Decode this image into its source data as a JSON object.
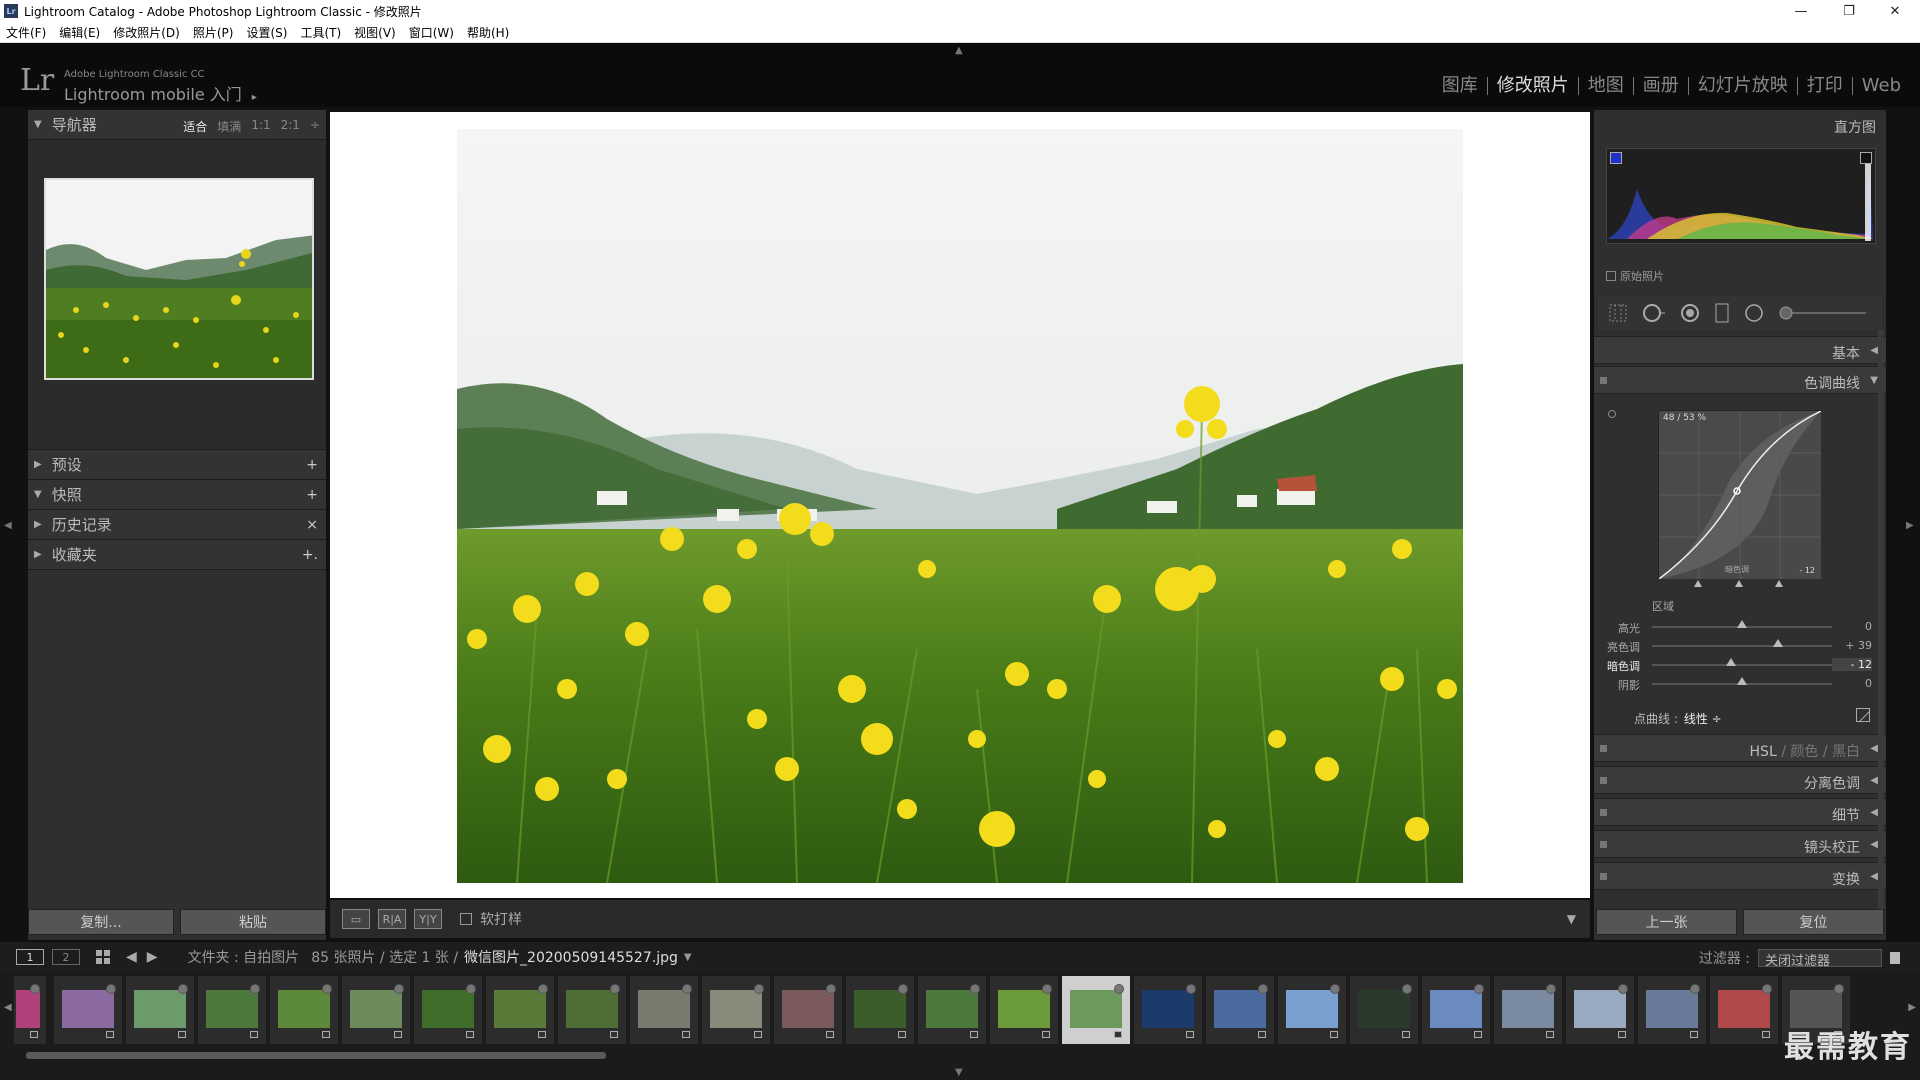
{
  "window": {
    "title": "Lightroom Catalog - Adobe Photoshop Lightroom Classic - 修改照片",
    "app_icon": "Lr"
  },
  "menu": [
    "文件(F)",
    "编辑(E)",
    "修改照片(D)",
    "照片(P)",
    "设置(S)",
    "工具(T)",
    "视图(V)",
    "窗口(W)",
    "帮助(H)"
  ],
  "header": {
    "logo": "Lr",
    "product": "Adobe Lightroom Classic CC",
    "mobile": "Lightroom mobile 入门",
    "mobile_arrow": "▸",
    "modules": [
      "图库",
      "修改照片",
      "地图",
      "画册",
      "幻灯片放映",
      "打印",
      "Web"
    ],
    "active_module": "修改照片"
  },
  "left": {
    "navigator": {
      "title": "导航器",
      "zoom": [
        "适合",
        "填满",
        "1:1",
        "2:1"
      ],
      "zoom_selected": "适合",
      "zoom_more": "÷"
    },
    "panels": [
      {
        "title": "预设",
        "action": "+",
        "tri": "▶"
      },
      {
        "title": "快照",
        "action": "+",
        "tri": "▼"
      },
      {
        "title": "历史记录",
        "action": "×",
        "tri": "▶"
      },
      {
        "title": "收藏夹",
        "action": "+.",
        "tri": "▶"
      }
    ],
    "buttons": {
      "copy": "复制...",
      "paste": "粘贴"
    }
  },
  "toolbar": {
    "ba_label": "R|A",
    "yy_label": "Y|Y",
    "softproof": "软打样",
    "dropdown": "▼"
  },
  "right": {
    "histogram": {
      "title": "直方图"
    },
    "original": "原始照片",
    "panels": {
      "basic": "基本",
      "tone_curve": "色调曲线",
      "hsl": "HSL",
      "color": "颜色",
      "bw": "黑白",
      "split": "分离色调",
      "detail": "细节",
      "lens": "镜头校正",
      "transform": "变换"
    },
    "curve": {
      "readout": "48 / 53 %",
      "foot_label": "暗色调",
      "foot_value": "- 12"
    },
    "region_label": "区域",
    "sliders": [
      {
        "name": "高光",
        "value": "0",
        "pos": 0.5
      },
      {
        "name": "亮色调",
        "value": "+ 39",
        "pos": 0.7
      },
      {
        "name": "暗色调",
        "value": "- 12",
        "pos": 0.44,
        "active": true
      },
      {
        "name": "阴影",
        "value": "0",
        "pos": 0.5
      }
    ],
    "point_curve": {
      "label": "点曲线 :",
      "value": "线性 ÷"
    },
    "buttons": {
      "prev": "上一张",
      "reset": "复位"
    }
  },
  "filmbar": {
    "screen1": "1",
    "screen2": "2",
    "path_prefix": "文件夹 : 自拍图片",
    "count": "85 张照片 / 选定 1 张 /",
    "filename": "微信图片_20200509145527.jpg",
    "filter_label": "过滤器 :",
    "filter_value": "关闭过滤器"
  },
  "colors": {
    "accent": "#dddddd",
    "panel": "#2f2f2f",
    "background": "#111111"
  },
  "watermark": "最需教育"
}
